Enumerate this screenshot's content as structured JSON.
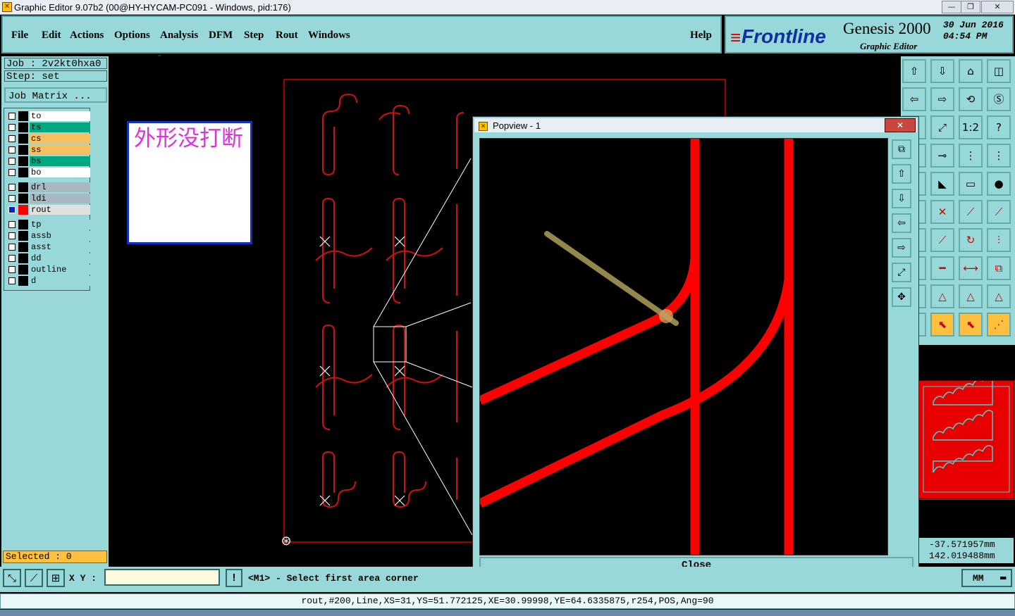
{
  "window": {
    "title": "Graphic Editor 9.07b2 (00@HY-HYCAM-PC091 - Windows, pid:176)"
  },
  "menu": {
    "items": [
      "File",
      "Edit",
      "Actions",
      "Options",
      "Analysis",
      "DFM",
      "Step",
      "Rout",
      "Windows"
    ],
    "help": "Help"
  },
  "brand": {
    "logo": "Frontline",
    "product": "Genesis 2000",
    "subtitle": "Graphic Editor",
    "date": "30 Jun 2016",
    "time": "04:54 PM"
  },
  "job": {
    "label": "Job : 2v2kt0hxa0",
    "step": "Step: set",
    "matrix_button": "Job Matrix ..."
  },
  "layers": [
    {
      "name": "to",
      "color": "#ffffff"
    },
    {
      "name": "ts",
      "color": "#00a880"
    },
    {
      "name": "cs",
      "color": "#f8c060"
    },
    {
      "name": "ss",
      "color": "#f8c060"
    },
    {
      "name": "bs",
      "color": "#00a880"
    },
    {
      "name": "bo",
      "color": "#ffffff"
    },
    {
      "name": "drl",
      "color": "#a8b8c0"
    },
    {
      "name": "ldi",
      "color": "#a8b8c0"
    },
    {
      "name": "rout",
      "color": "#e0e0e0",
      "active": true
    },
    {
      "name": "tp",
      "color": "#98d8d8"
    },
    {
      "name": "assb",
      "color": "#98d8d8"
    },
    {
      "name": "asst",
      "color": "#98d8d8"
    },
    {
      "name": "dd",
      "color": "#98d8d8"
    },
    {
      "name": "outline",
      "color": "#98d8d8"
    },
    {
      "name": "d",
      "color": "#98d8d8"
    }
  ],
  "selected": "Selected : 0",
  "note": {
    "text": "外形没打断"
  },
  "popview": {
    "title": "Popview - 1",
    "close": "Close"
  },
  "coords": {
    "x": "-37.571957mm",
    "y": "142.019488mm"
  },
  "input": {
    "xy_label": "X Y :",
    "value": "",
    "prompt": "<M1> - Select first area corner",
    "unit": "MM"
  },
  "status": {
    "line": "rout,#200,Line,XS=31,YS=51.772125,XE=30.99998,YE=64.6335875,r254,POS,Ang=90"
  },
  "colors": {
    "panel": "#98d8d8",
    "route": "#ff0000",
    "accent": "#ffc040"
  }
}
